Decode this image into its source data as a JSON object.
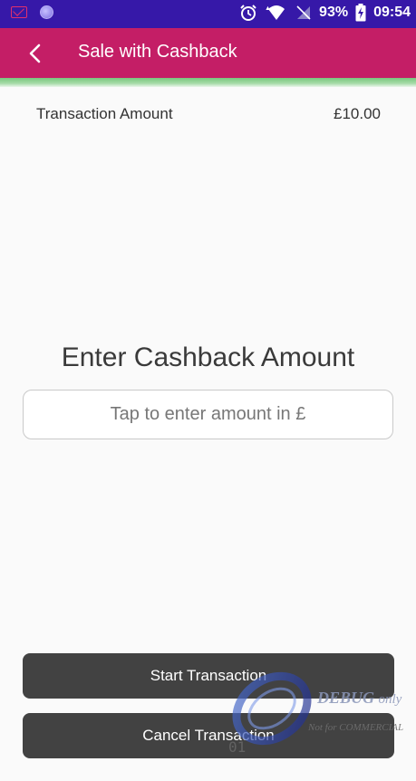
{
  "status_bar": {
    "battery_percent": "93%",
    "time": "09:54",
    "icons": [
      "mail-icon",
      "globe-icon",
      "alarm-icon",
      "wifi-icon",
      "no-signal-icon",
      "battery-charging-icon"
    ]
  },
  "app_bar": {
    "title": "Sale with Cashback",
    "back_icon": "chevron-left-icon",
    "color": "#c41e66"
  },
  "transaction": {
    "label": "Transaction Amount",
    "value": "£10.00"
  },
  "cashback": {
    "title": "Enter Cashback Amount",
    "placeholder": "Tap to enter amount in £",
    "value": ""
  },
  "buttons": {
    "start_label": "Start Transaction",
    "cancel_label": "Cancel Transaction"
  },
  "watermark": {
    "line1": "DEBUG",
    "line1_suffix": "only",
    "line2": "Not for COMMERCIAL",
    "mark": "01"
  }
}
